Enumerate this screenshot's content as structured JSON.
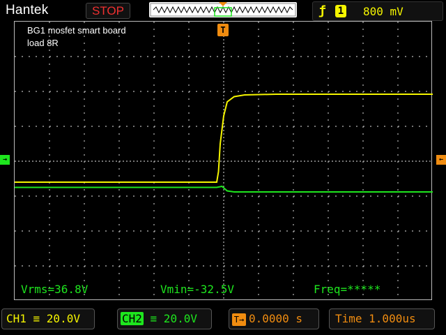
{
  "header": {
    "brand": "Hantek",
    "run_state": "STOP",
    "trigger": {
      "edge_icon": "rising-edge-icon",
      "edge_glyph": "ƒ",
      "source": "1",
      "level": "800  mV"
    }
  },
  "annotations": {
    "line1": "BG1 mosfet smart board",
    "line2": "load 8R"
  },
  "markers": {
    "trigger": "T",
    "ch_left": "→",
    "ch_right": "←"
  },
  "measurements": {
    "vrms": "Vrms=36.8V",
    "vmin": "Vmin=-32.5V",
    "freq": "Freq=*****"
  },
  "footer": {
    "ch1": "CH1 ≡ 20.0V",
    "ch2_badge": "CH2",
    "ch2_value": " ≡ 20.0V",
    "trigger_offset_badge": "T→",
    "trigger_offset": "0.0000 s",
    "timebase": "Time 1.000us"
  },
  "colors": {
    "ch1": "#f5f500",
    "ch2": "#1ee61e",
    "accent": "#f08c10",
    "stop": "#f03030"
  },
  "chart_data": {
    "type": "line",
    "series": [
      {
        "name": "CH1",
        "points": [
          [
            0,
            -0.6
          ],
          [
            1.5,
            -0.6
          ],
          [
            3.0,
            -0.6
          ],
          [
            4.5,
            -0.6
          ],
          [
            5.8,
            -0.6
          ],
          [
            5.85,
            -0.3
          ],
          [
            5.9,
            0.5
          ],
          [
            6.0,
            1.3
          ],
          [
            6.1,
            1.7
          ],
          [
            6.3,
            1.85
          ],
          [
            6.6,
            1.9
          ],
          [
            7.5,
            1.92
          ],
          [
            9.0,
            1.92
          ],
          [
            12.0,
            1.92
          ]
        ]
      },
      {
        "name": "CH2",
        "points": [
          [
            0,
            -0.75
          ],
          [
            5.8,
            -0.75
          ],
          [
            5.95,
            -0.72
          ],
          [
            6.1,
            -0.85
          ],
          [
            6.3,
            -0.88
          ],
          [
            12.0,
            -0.88
          ]
        ]
      }
    ],
    "xlim": [
      0,
      12
    ],
    "ylim": [
      -4,
      4
    ],
    "grid": true
  }
}
